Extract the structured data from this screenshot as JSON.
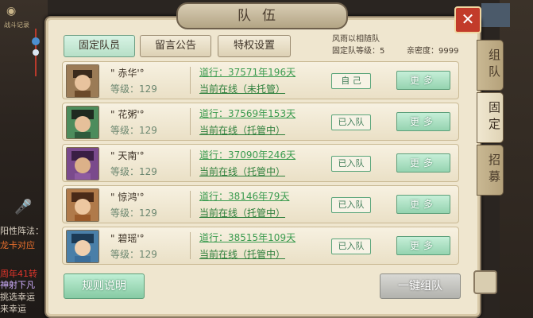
{
  "window": {
    "title": "队伍",
    "close_label": "✕"
  },
  "left_strip": {
    "caption": "战斗记录",
    "lines": [
      "阳性阵法：",
      "龙卡对应",
      "周年41转",
      "神射下凡",
      "挑选幸运",
      "来幸运"
    ]
  },
  "top_tabs": [
    {
      "label": "固定队员",
      "active": true
    },
    {
      "label": "留言公告",
      "active": false
    },
    {
      "label": "特权设置",
      "active": false
    }
  ],
  "team_info": {
    "name": "风雨以相随队",
    "level_label": "固定队等级：5",
    "intimacy_label": "亲密度：9999"
  },
  "members": [
    {
      "name": "\" 赤华'°",
      "level": "等级：129",
      "daoxing": "道行：37571年196天",
      "online": "当前在线（未托管）",
      "status": "自 己",
      "more": "更多"
    },
    {
      "name": "\" 花粥'°",
      "level": "等级：129",
      "daoxing": "道行：37569年153天",
      "online": "当前在线（托管中）",
      "status": "已入队",
      "more": "更多"
    },
    {
      "name": "\" 天南'°",
      "level": "等级：129",
      "daoxing": "道行：37090年246天",
      "online": "当前在线（托管中）",
      "status": "已入队",
      "more": "更多"
    },
    {
      "name": "\" 惊鸿'°",
      "level": "等级：129",
      "daoxing": "道行：38146年79天",
      "online": "当前在线（托管中）",
      "status": "已入队",
      "more": "更多"
    },
    {
      "name": "\" 碧瑶'°",
      "level": "等级：129",
      "daoxing": "道行：38515年109天",
      "online": "当前在线（托管中）",
      "status": "已入队",
      "more": "更多"
    }
  ],
  "bottom": {
    "rules_label": "规则说明",
    "one_click_label": "一键组队"
  },
  "side_tabs": [
    {
      "label": "组队",
      "active": false
    },
    {
      "label": "固定",
      "active": true
    },
    {
      "label": "招募",
      "active": false
    }
  ],
  "colors": {
    "accent_green": "#3b9b4f",
    "close_red": "#c23b2a",
    "panel_bg": "#efe6cf"
  }
}
